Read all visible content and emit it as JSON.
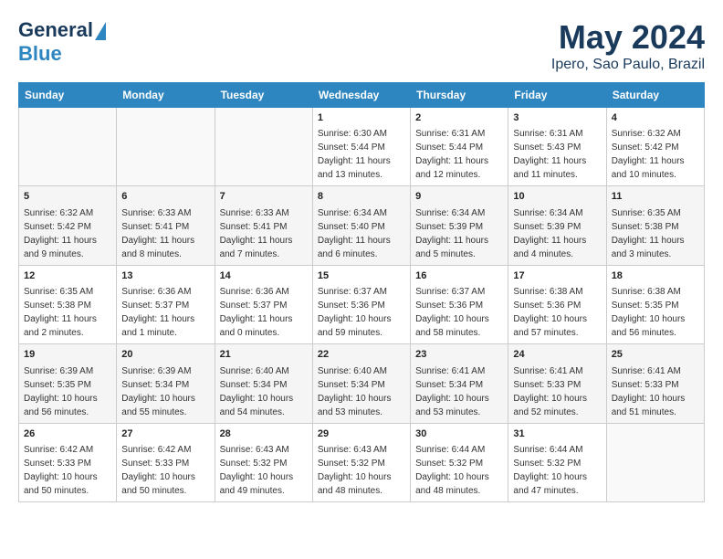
{
  "header": {
    "logo_line1": "General",
    "logo_line2": "Blue",
    "title": "May 2024",
    "subtitle": "Ipero, Sao Paulo, Brazil"
  },
  "days_of_week": [
    "Sunday",
    "Monday",
    "Tuesday",
    "Wednesday",
    "Thursday",
    "Friday",
    "Saturday"
  ],
  "weeks": [
    [
      {
        "day": "",
        "info": ""
      },
      {
        "day": "",
        "info": ""
      },
      {
        "day": "",
        "info": ""
      },
      {
        "day": "1",
        "info": "Sunrise: 6:30 AM\nSunset: 5:44 PM\nDaylight: 11 hours and 13 minutes."
      },
      {
        "day": "2",
        "info": "Sunrise: 6:31 AM\nSunset: 5:44 PM\nDaylight: 11 hours and 12 minutes."
      },
      {
        "day": "3",
        "info": "Sunrise: 6:31 AM\nSunset: 5:43 PM\nDaylight: 11 hours and 11 minutes."
      },
      {
        "day": "4",
        "info": "Sunrise: 6:32 AM\nSunset: 5:42 PM\nDaylight: 11 hours and 10 minutes."
      }
    ],
    [
      {
        "day": "5",
        "info": "Sunrise: 6:32 AM\nSunset: 5:42 PM\nDaylight: 11 hours and 9 minutes."
      },
      {
        "day": "6",
        "info": "Sunrise: 6:33 AM\nSunset: 5:41 PM\nDaylight: 11 hours and 8 minutes."
      },
      {
        "day": "7",
        "info": "Sunrise: 6:33 AM\nSunset: 5:41 PM\nDaylight: 11 hours and 7 minutes."
      },
      {
        "day": "8",
        "info": "Sunrise: 6:34 AM\nSunset: 5:40 PM\nDaylight: 11 hours and 6 minutes."
      },
      {
        "day": "9",
        "info": "Sunrise: 6:34 AM\nSunset: 5:39 PM\nDaylight: 11 hours and 5 minutes."
      },
      {
        "day": "10",
        "info": "Sunrise: 6:34 AM\nSunset: 5:39 PM\nDaylight: 11 hours and 4 minutes."
      },
      {
        "day": "11",
        "info": "Sunrise: 6:35 AM\nSunset: 5:38 PM\nDaylight: 11 hours and 3 minutes."
      }
    ],
    [
      {
        "day": "12",
        "info": "Sunrise: 6:35 AM\nSunset: 5:38 PM\nDaylight: 11 hours and 2 minutes."
      },
      {
        "day": "13",
        "info": "Sunrise: 6:36 AM\nSunset: 5:37 PM\nDaylight: 11 hours and 1 minute."
      },
      {
        "day": "14",
        "info": "Sunrise: 6:36 AM\nSunset: 5:37 PM\nDaylight: 11 hours and 0 minutes."
      },
      {
        "day": "15",
        "info": "Sunrise: 6:37 AM\nSunset: 5:36 PM\nDaylight: 10 hours and 59 minutes."
      },
      {
        "day": "16",
        "info": "Sunrise: 6:37 AM\nSunset: 5:36 PM\nDaylight: 10 hours and 58 minutes."
      },
      {
        "day": "17",
        "info": "Sunrise: 6:38 AM\nSunset: 5:36 PM\nDaylight: 10 hours and 57 minutes."
      },
      {
        "day": "18",
        "info": "Sunrise: 6:38 AM\nSunset: 5:35 PM\nDaylight: 10 hours and 56 minutes."
      }
    ],
    [
      {
        "day": "19",
        "info": "Sunrise: 6:39 AM\nSunset: 5:35 PM\nDaylight: 10 hours and 56 minutes."
      },
      {
        "day": "20",
        "info": "Sunrise: 6:39 AM\nSunset: 5:34 PM\nDaylight: 10 hours and 55 minutes."
      },
      {
        "day": "21",
        "info": "Sunrise: 6:40 AM\nSunset: 5:34 PM\nDaylight: 10 hours and 54 minutes."
      },
      {
        "day": "22",
        "info": "Sunrise: 6:40 AM\nSunset: 5:34 PM\nDaylight: 10 hours and 53 minutes."
      },
      {
        "day": "23",
        "info": "Sunrise: 6:41 AM\nSunset: 5:34 PM\nDaylight: 10 hours and 53 minutes."
      },
      {
        "day": "24",
        "info": "Sunrise: 6:41 AM\nSunset: 5:33 PM\nDaylight: 10 hours and 52 minutes."
      },
      {
        "day": "25",
        "info": "Sunrise: 6:41 AM\nSunset: 5:33 PM\nDaylight: 10 hours and 51 minutes."
      }
    ],
    [
      {
        "day": "26",
        "info": "Sunrise: 6:42 AM\nSunset: 5:33 PM\nDaylight: 10 hours and 50 minutes."
      },
      {
        "day": "27",
        "info": "Sunrise: 6:42 AM\nSunset: 5:33 PM\nDaylight: 10 hours and 50 minutes."
      },
      {
        "day": "28",
        "info": "Sunrise: 6:43 AM\nSunset: 5:32 PM\nDaylight: 10 hours and 49 minutes."
      },
      {
        "day": "29",
        "info": "Sunrise: 6:43 AM\nSunset: 5:32 PM\nDaylight: 10 hours and 48 minutes."
      },
      {
        "day": "30",
        "info": "Sunrise: 6:44 AM\nSunset: 5:32 PM\nDaylight: 10 hours and 48 minutes."
      },
      {
        "day": "31",
        "info": "Sunrise: 6:44 AM\nSunset: 5:32 PM\nDaylight: 10 hours and 47 minutes."
      },
      {
        "day": "",
        "info": ""
      }
    ]
  ]
}
